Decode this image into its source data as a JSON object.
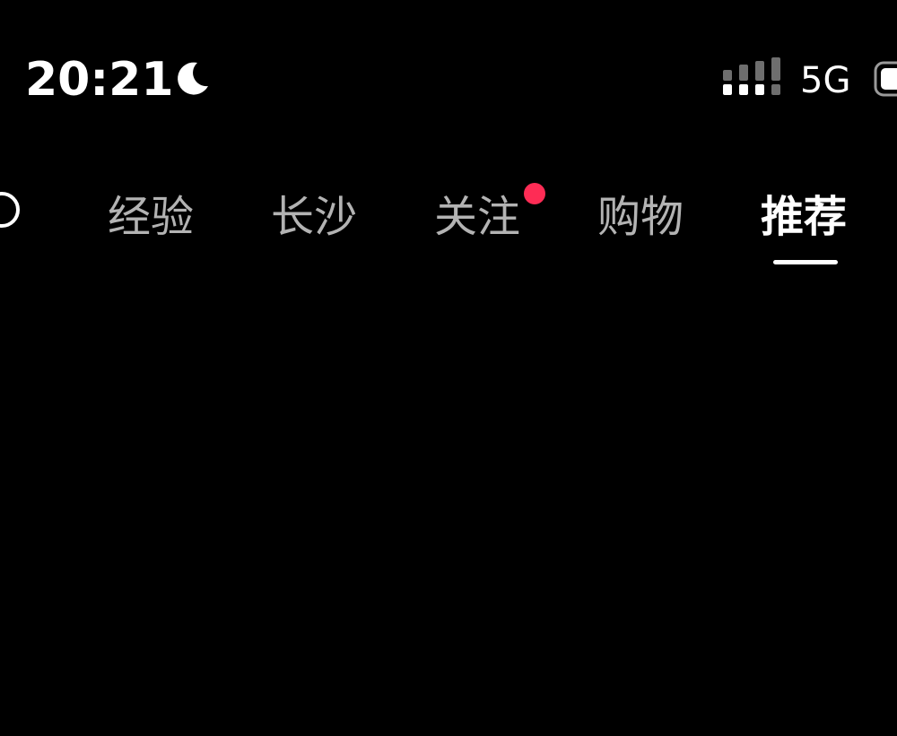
{
  "status_bar": {
    "time": "20:21",
    "moon_icon": "moon-icon",
    "signal_icon": "signal-bars-icon",
    "network": "5G",
    "battery_icon": "battery-icon"
  },
  "nav": {
    "edge_icon": "circle-icon",
    "tabs": [
      {
        "label": "经验",
        "active": false
      },
      {
        "label": "长沙",
        "active": false
      },
      {
        "label": "关注",
        "active": false,
        "has_dot": true
      },
      {
        "label": "购物",
        "active": false
      },
      {
        "label": "推荐",
        "active": true
      }
    ]
  },
  "colors": {
    "background": "#000000",
    "tab_inactive": "#b3b3b3",
    "tab_active": "#ffffff",
    "notify_dot": "#fe2c55"
  }
}
